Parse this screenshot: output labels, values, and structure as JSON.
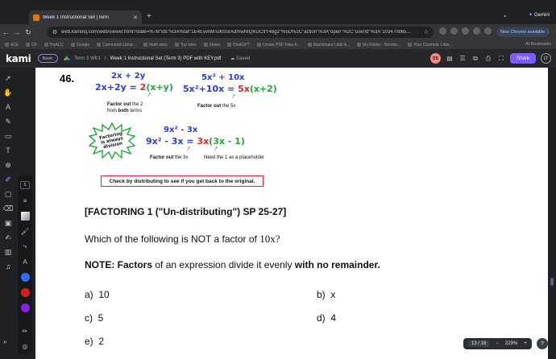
{
  "browser": {
    "tab_title": "Week 1 Instructional Set (Term",
    "new_tab": "+",
    "gemini_label": "Gemini",
    "url": "web.kamihq.com/web/viewer.html?state=%7B\"ids\"%3A%5B\"1E4EvvnMTo6SSrAdmwNIQKGCffY48g2\"%5D%2C\"action\"%3A\"open\"%2C\"userId\"%3A\"103470865...",
    "update_button": "New Chrome available",
    "bookmarks": [
      "ACE",
      "CF",
      "HoACC",
      "Google",
      "Commonlit Librar...",
      "Math sites",
      "Top sites",
      "Slaws",
      "ChatGPT",
      "Create PDF Files A...",
      "Blackboard Little A...",
      "My Folder - Notebo...",
      "Your Cosmetic Little..."
    ],
    "all_bookmarks": "All Bookmarks"
  },
  "kami": {
    "logo": "kami",
    "plan": "Basic",
    "breadcrumb_term": "Term 3 WK1",
    "doc_title": "Week 1 Instructional Set (Term 3) PDF with KEY.pdf",
    "saved": "Saved",
    "avatar_initials": "DS",
    "share_label": "Share",
    "user_initials": "LT"
  },
  "tools": {
    "stroke_width": "1",
    "colors": [
      "#2f6df5",
      "#d21f1f",
      "#8a1fe0"
    ]
  },
  "document": {
    "question_number": "46.",
    "ex1_top": "2x + 2y",
    "ex1_line_a": "2x+2y = ",
    "ex1_factor": "2",
    "ex1_paren": "(x+y)",
    "ex1_note_a": "Factor out",
    "ex1_note_b": " the 2",
    "ex1_note_c": "from ",
    "ex1_note_d": "both",
    "ex1_note_e": " terms",
    "ex2_top": "5x² + 10x",
    "ex2_line_a": "5x²+10x = ",
    "ex2_factor": "5x",
    "ex2_paren": "(x+2)",
    "ex2_note_a": "Factor out",
    "ex2_note_b": " the 5x",
    "burst_text": "Factoring is always division",
    "ex3_top": "9x² - 3x",
    "ex3_line_a": "9x² - 3x = ",
    "ex3_factor": "3x",
    "ex3_paren": "(3x - 1)",
    "ex3_note_a": "Factor out",
    "ex3_note_b": " the 3x",
    "ex3_note2": "Need the 1 as a placeholder",
    "check_text": "Check by distributing to see if you get back to the original.",
    "section_title": "[FACTORING 1 (\"Un-distributing\") SP 25-27]",
    "question_text": "Which of the following is NOT a factor of ",
    "question_math": "10x?",
    "note_a": "NOTE: Factors",
    "note_b": " of an expression divide it evenly ",
    "note_c": "with no remainder.",
    "choices": [
      {
        "letter": "a)",
        "value": "10"
      },
      {
        "letter": "b)",
        "value": "x"
      },
      {
        "letter": "c)",
        "value": "5"
      },
      {
        "letter": "d)",
        "value": "4"
      },
      {
        "letter": "e)",
        "value": "2"
      }
    ]
  },
  "page_controls": {
    "page": "13 / 16",
    "zoom": "229%",
    "minus": "−",
    "plus": "+",
    "help": "?"
  }
}
